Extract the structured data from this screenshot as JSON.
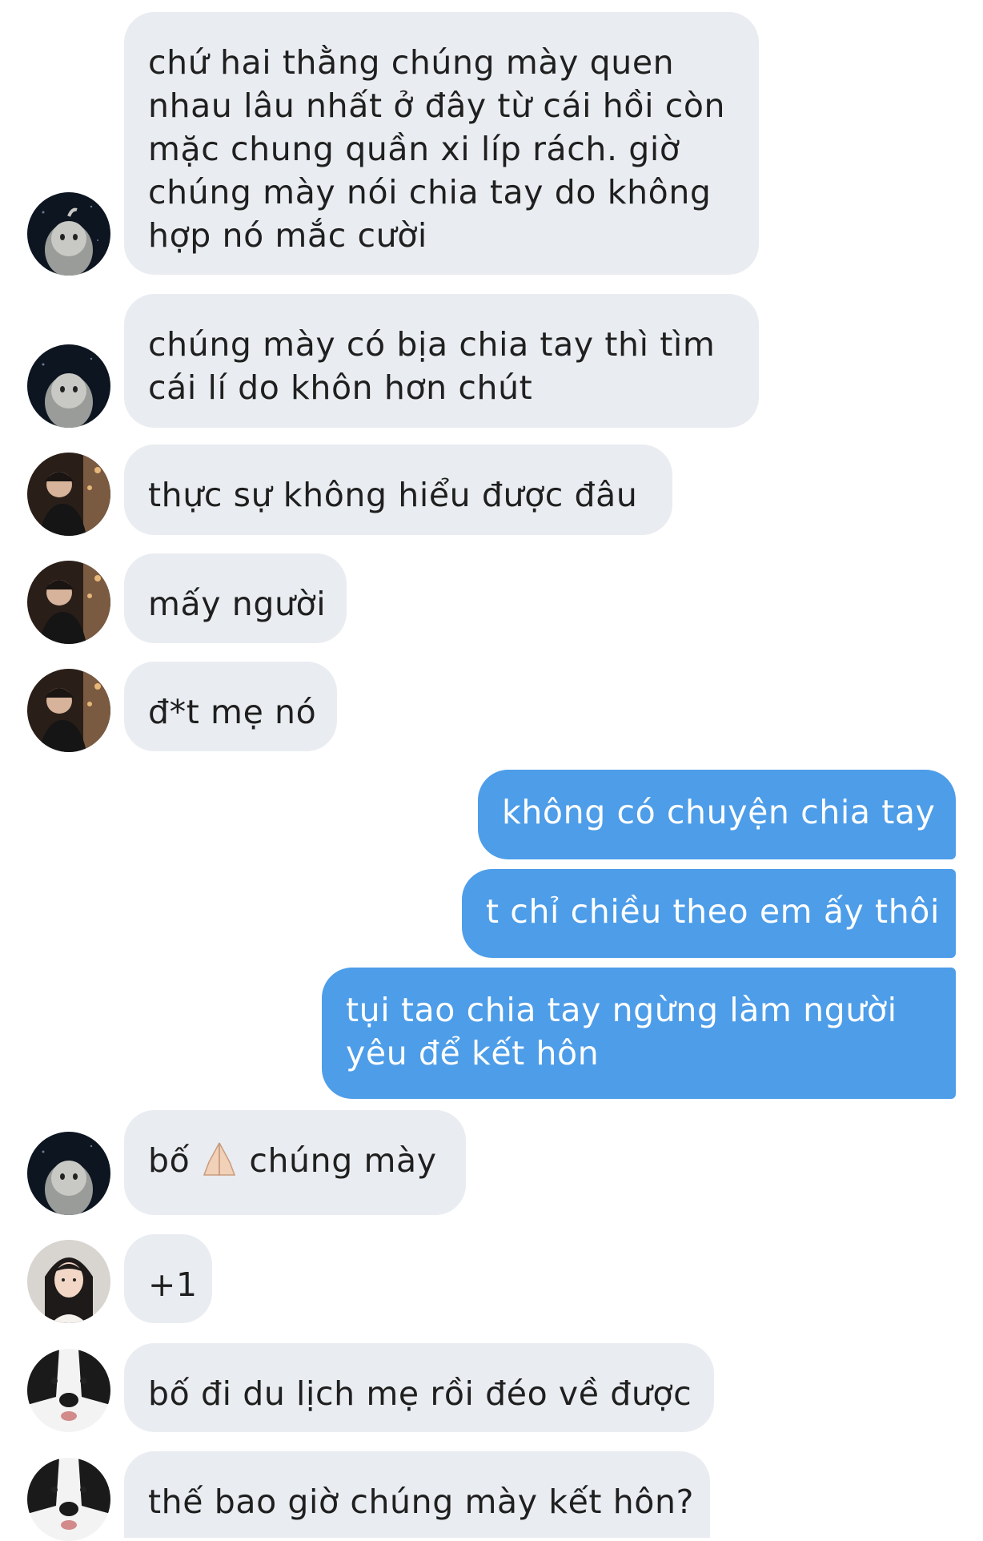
{
  "conversation": {
    "messages": [
      {
        "sender": "ghost-avatar",
        "direction": "incoming",
        "lines": [
          "chứ hai thằng chúng mày quen",
          "nhau lâu nhất ở đây từ cái hồi còn",
          "mặc chung quần xi líp rách. giờ",
          "chúng mày nói chia tay do không",
          "hợp nó mắc cười"
        ]
      },
      {
        "sender": "ghost-avatar",
        "direction": "incoming",
        "lines": [
          "chúng mày có bịa chia tay thì tìm",
          "cái lí do khôn hơn chút"
        ]
      },
      {
        "sender": "guy-avatar",
        "direction": "incoming",
        "lines": [
          "thực sự không hiểu được đâu"
        ]
      },
      {
        "sender": "guy-avatar",
        "direction": "incoming",
        "lines": [
          "mấy người"
        ]
      },
      {
        "sender": "guy-avatar",
        "direction": "incoming",
        "lines": [
          "đ*t mẹ nó"
        ]
      },
      {
        "sender": "me",
        "direction": "outgoing",
        "lines": [
          "không có chuyện chia tay"
        ]
      },
      {
        "sender": "me",
        "direction": "outgoing",
        "lines": [
          "t chỉ chiều theo em ấy thôi"
        ]
      },
      {
        "sender": "me",
        "direction": "outgoing",
        "lines": [
          "tụi tao chia tay ngừng làm người",
          "yêu để kết hôn"
        ]
      },
      {
        "sender": "ghost-avatar",
        "direction": "incoming",
        "before_emoji": "bố",
        "emoji": "folded-hands-emoji",
        "after_emoji": "chúng mày"
      },
      {
        "sender": "girl-avatar",
        "direction": "incoming",
        "lines": [
          "+1"
        ]
      },
      {
        "sender": "dog-avatar",
        "direction": "incoming",
        "lines": [
          "bố đi du lịch mẹ rồi đéo về được"
        ]
      },
      {
        "sender": "dog-avatar",
        "direction": "incoming",
        "lines": [
          "thế bao giờ chúng mày kết hôn?"
        ]
      }
    ]
  },
  "colors": {
    "incoming_bubble": "#e9ecf0",
    "outgoing_bubble": "#4d9de9",
    "incoming_text": "#1f1f1f",
    "outgoing_text": "#ffffff"
  }
}
